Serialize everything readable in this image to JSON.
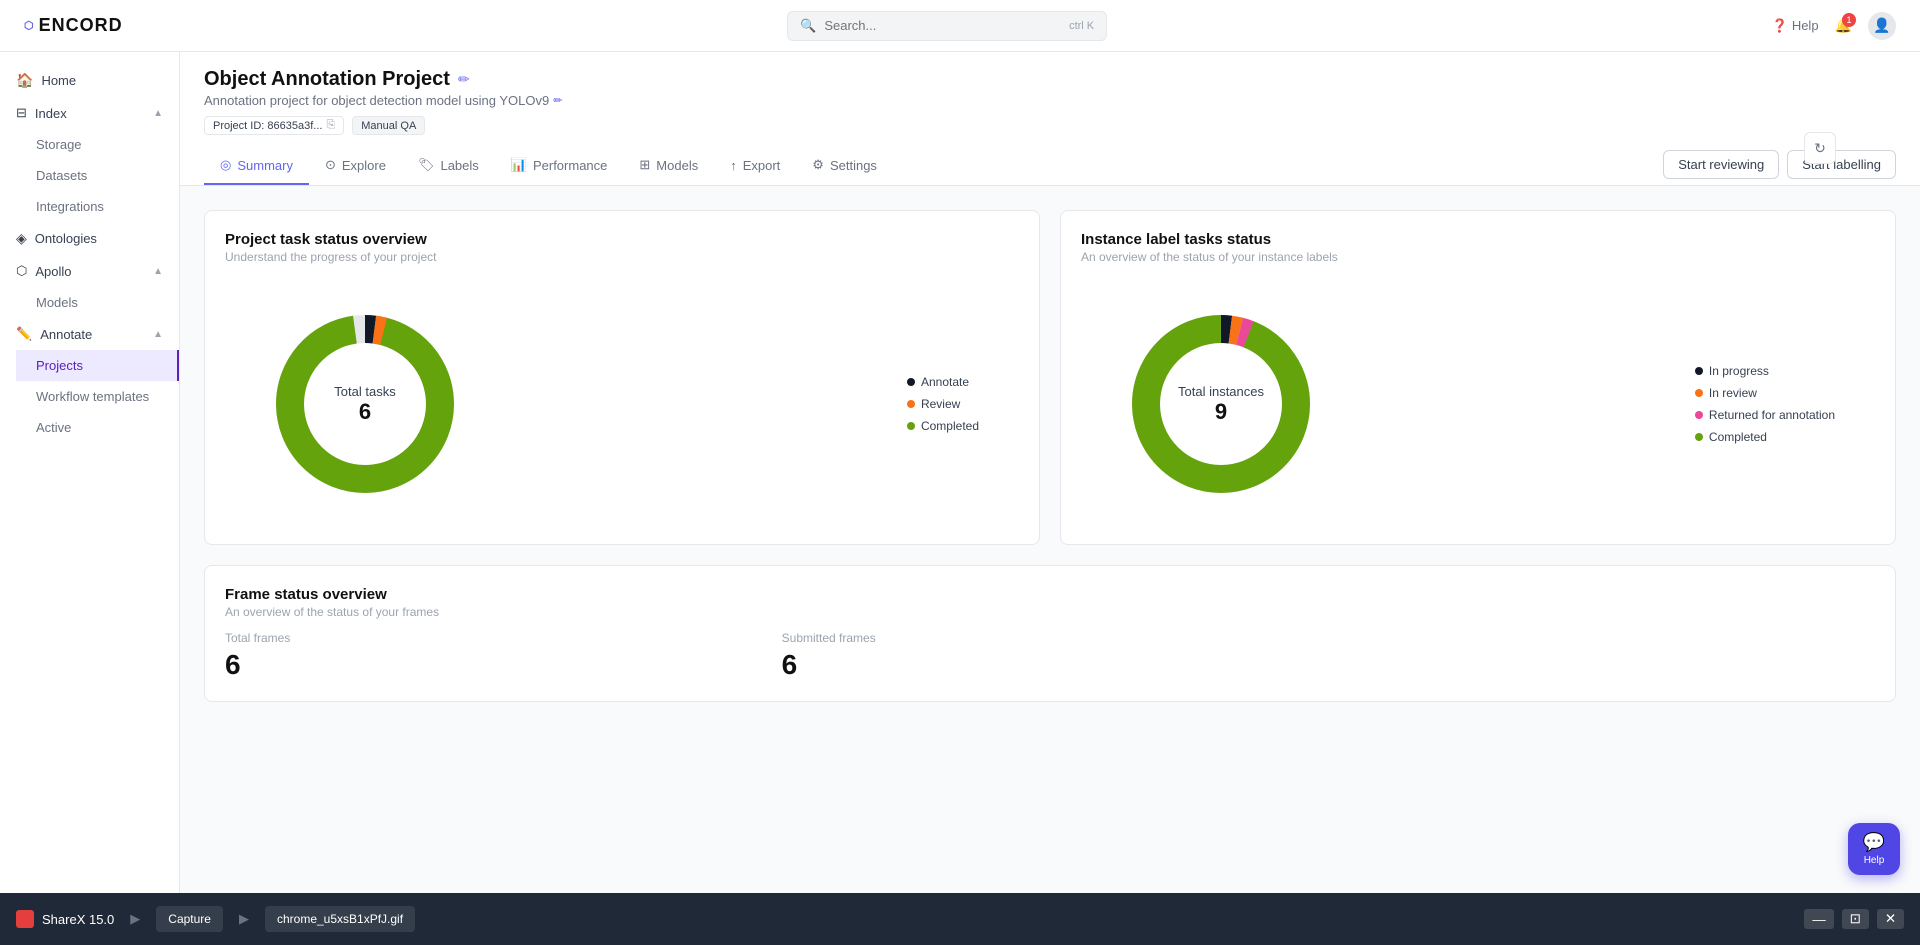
{
  "app": {
    "logo": "ENCORD",
    "logo_icon": "○"
  },
  "topbar": {
    "search_placeholder": "Search...",
    "search_shortcut": "ctrl K",
    "help_label": "Help",
    "notification_count": "1"
  },
  "sidebar": {
    "home_label": "Home",
    "index_label": "Index",
    "storage_label": "Storage",
    "datasets_label": "Datasets",
    "integrations_label": "Integrations",
    "ontologies_label": "Ontologies",
    "apollo_label": "Apollo",
    "models_label": "Models",
    "annotate_label": "Annotate",
    "projects_label": "Projects",
    "workflow_templates_label": "Workflow templates",
    "active_label": "Active"
  },
  "project": {
    "title": "Object Annotation Project",
    "description": "Annotation project for object detection model using YOLOv9",
    "project_id_label": "Project ID: 86635a3f...",
    "manual_qa_label": "Manual QA",
    "tabs": [
      {
        "id": "summary",
        "label": "Summary",
        "icon": "◎"
      },
      {
        "id": "explore",
        "label": "Explore",
        "icon": "🔍"
      },
      {
        "id": "labels",
        "label": "Labels",
        "icon": "🏷"
      },
      {
        "id": "performance",
        "label": "Performance",
        "icon": "📊"
      },
      {
        "id": "models",
        "label": "Models",
        "icon": "⊞"
      },
      {
        "id": "export",
        "label": "Export",
        "icon": "↑"
      },
      {
        "id": "settings",
        "label": "Settings",
        "icon": "⚙"
      }
    ],
    "active_tab": "summary",
    "start_reviewing_label": "Start reviewing",
    "start_labelling_label": "Start labelling"
  },
  "task_status": {
    "title": "Project task status overview",
    "subtitle": "Understand the progress of your project",
    "total_tasks_label": "Total tasks",
    "total_tasks_value": "6",
    "segments": [
      {
        "label": "Annotate",
        "color": "#111827",
        "value": 0.02,
        "offset": 0
      },
      {
        "label": "Review",
        "color": "#f97316",
        "value": 0.02,
        "offset": 2
      },
      {
        "label": "Completed",
        "color": "#65a30d",
        "value": 0.96,
        "offset": 4
      }
    ]
  },
  "instance_status": {
    "title": "Instance label tasks status",
    "subtitle": "An overview of the status of your instance labels",
    "total_instances_label": "Total instances",
    "total_instances_value": "9",
    "segments": [
      {
        "label": "In progress",
        "color": "#111827",
        "value": 0.02,
        "offset": 0
      },
      {
        "label": "In review",
        "color": "#f97316",
        "value": 0.02,
        "offset": 2
      },
      {
        "label": "Returned for annotation",
        "color": "#ec4899",
        "value": 0.02,
        "offset": 4
      },
      {
        "label": "Completed",
        "color": "#65a30d",
        "value": 0.94,
        "offset": 6
      }
    ]
  },
  "frame_status": {
    "title": "Frame status overview",
    "subtitle": "An overview of the status of your frames",
    "stats": [
      {
        "label": "Total frames",
        "value": "6"
      },
      {
        "label": "Submitted frames",
        "value": "6"
      }
    ]
  },
  "taskbar": {
    "app_label": "ShareX 15.0",
    "capture_label": "Capture",
    "filename": "chrome_u5xsB1xPfJ.gif"
  },
  "help_fab": {
    "label": "Help"
  }
}
